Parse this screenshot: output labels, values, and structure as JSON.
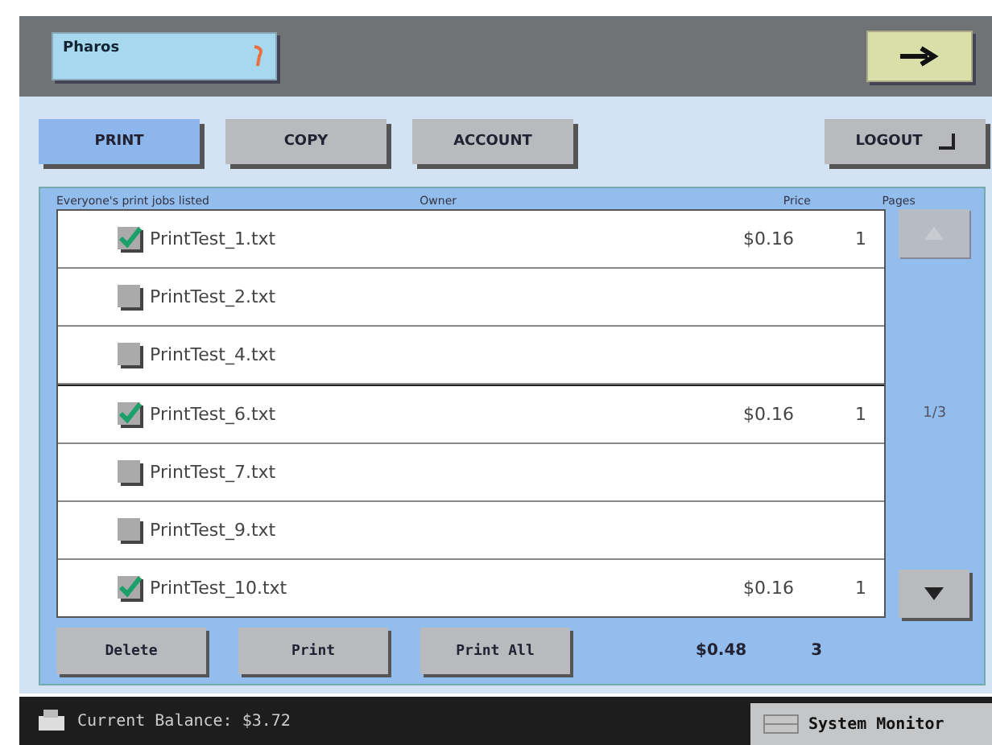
{
  "header": {
    "title": "Pharos"
  },
  "tabs": [
    {
      "label": "PRINT",
      "selected": true
    },
    {
      "label": "COPY",
      "selected": false
    },
    {
      "label": "ACCOUNT",
      "selected": false
    }
  ],
  "logout": {
    "label": "LOGOUT"
  },
  "table": {
    "caption": "Everyone's print jobs listed",
    "columns": [
      "Owner",
      "Price",
      "Pages"
    ],
    "rows": [
      {
        "name": "PrintTest_1.txt",
        "checked": true,
        "price": "$0.16",
        "pages": "1"
      },
      {
        "name": "PrintTest_2.txt",
        "checked": false
      },
      {
        "name": "PrintTest_4.txt",
        "checked": false
      },
      {
        "name": "PrintTest_6.txt",
        "checked": true,
        "price": "$0.16",
        "pages": "1"
      },
      {
        "name": "PrintTest_7.txt",
        "checked": false
      },
      {
        "name": "PrintTest_9.txt",
        "checked": false
      },
      {
        "name": "PrintTest_10.txt",
        "checked": true,
        "price": "$0.16",
        "pages": "1"
      }
    ]
  },
  "pager": {
    "page": "1/3",
    "up_disabled": true,
    "down_disabled": false
  },
  "actions": [
    "Delete",
    "Print",
    "Print All"
  ],
  "totals": {
    "price": "$0.48",
    "pages": "3"
  },
  "status_bar": {
    "balance": "Current Balance: $3.72",
    "monitor": "System Monitor"
  }
}
